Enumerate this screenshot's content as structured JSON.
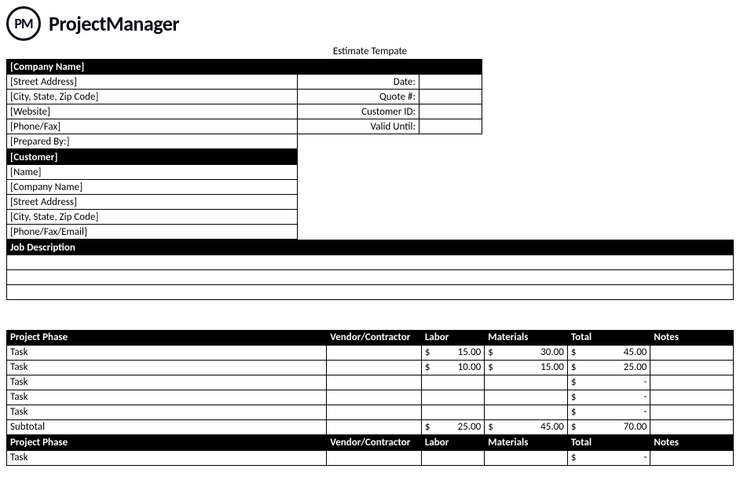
{
  "logo": {
    "badge": "PM",
    "name": "ProjectManager"
  },
  "title": "Estimate Tempate",
  "company_section": {
    "header": "[Company Name]",
    "fields": [
      "[Street Address]",
      "[City, State, Zip Code]",
      "[Website]",
      "[Phone/Fax]",
      "[Prepared By:]"
    ]
  },
  "meta_labels": {
    "date": "Date:",
    "quote": "Quote #:",
    "customer_id": "Customer ID:",
    "valid_until": "Valid Until:"
  },
  "meta_values": {
    "date": "",
    "quote": "",
    "customer_id": "",
    "valid_until": ""
  },
  "customer_section": {
    "header": "[Customer]",
    "fields": [
      "[Name]",
      "[Company Name]",
      "[Street Address]",
      "[City, State, Zip Code]",
      "[Phone/Fax/Email]"
    ]
  },
  "job_description_header": "Job Description",
  "phase_headers": {
    "phase": "Project Phase",
    "vendor": "Vendor/Contractor",
    "labor": "Labor",
    "materials": "Materials",
    "total": "Total",
    "notes": "Notes"
  },
  "currency": "$",
  "phase1": {
    "rows": [
      {
        "task": "Task",
        "labor": "15.00",
        "materials": "30.00",
        "total": "45.00"
      },
      {
        "task": "Task",
        "labor": "10.00",
        "materials": "15.00",
        "total": "25.00"
      },
      {
        "task": "Task",
        "labor": "",
        "materials": "",
        "total": "-"
      },
      {
        "task": "Task",
        "labor": "",
        "materials": "",
        "total": "-"
      },
      {
        "task": "Task",
        "labor": "",
        "materials": "",
        "total": "-"
      }
    ],
    "subtotal_label": "Subtotal",
    "subtotal": {
      "labor": "25.00",
      "materials": "45.00",
      "total": "70.00"
    }
  },
  "phase2": {
    "rows": [
      {
        "task": "Task",
        "labor": "",
        "materials": "",
        "total": "-"
      }
    ]
  }
}
